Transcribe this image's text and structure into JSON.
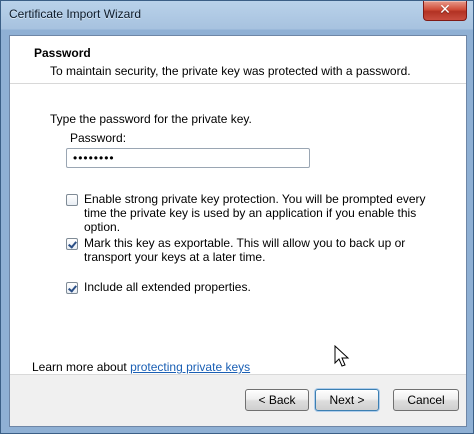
{
  "window": {
    "title": "Certificate Import Wizard",
    "close_glyph": "✕"
  },
  "header": {
    "title": "Password",
    "subtitle": "To maintain security, the private key was protected with a password."
  },
  "body": {
    "instruction": "Type the password for the private key.",
    "password_label": "Password:",
    "password_value": "••••••••",
    "options": [
      {
        "label": "Enable strong private key protection. You will be prompted every time the private key is used by an application if you enable this option.",
        "checked": false
      },
      {
        "label": "Mark this key as exportable. This will allow you to back up or transport your keys at a later time.",
        "checked": true
      },
      {
        "label": "Include all extended properties.",
        "checked": true
      }
    ],
    "learn_more_prefix": "Learn more about ",
    "learn_more_link": "protecting private keys"
  },
  "footer": {
    "back_label": "< Back",
    "next_label": "Next >",
    "cancel_label": "Cancel"
  },
  "icons": {
    "close": "close-icon",
    "check": "checkmark-icon",
    "cursor": "mouse-cursor-icon"
  },
  "colors": {
    "link": "#1a5fb4",
    "close_button": "#c94d3f",
    "checkmark": "#2b4f86"
  }
}
